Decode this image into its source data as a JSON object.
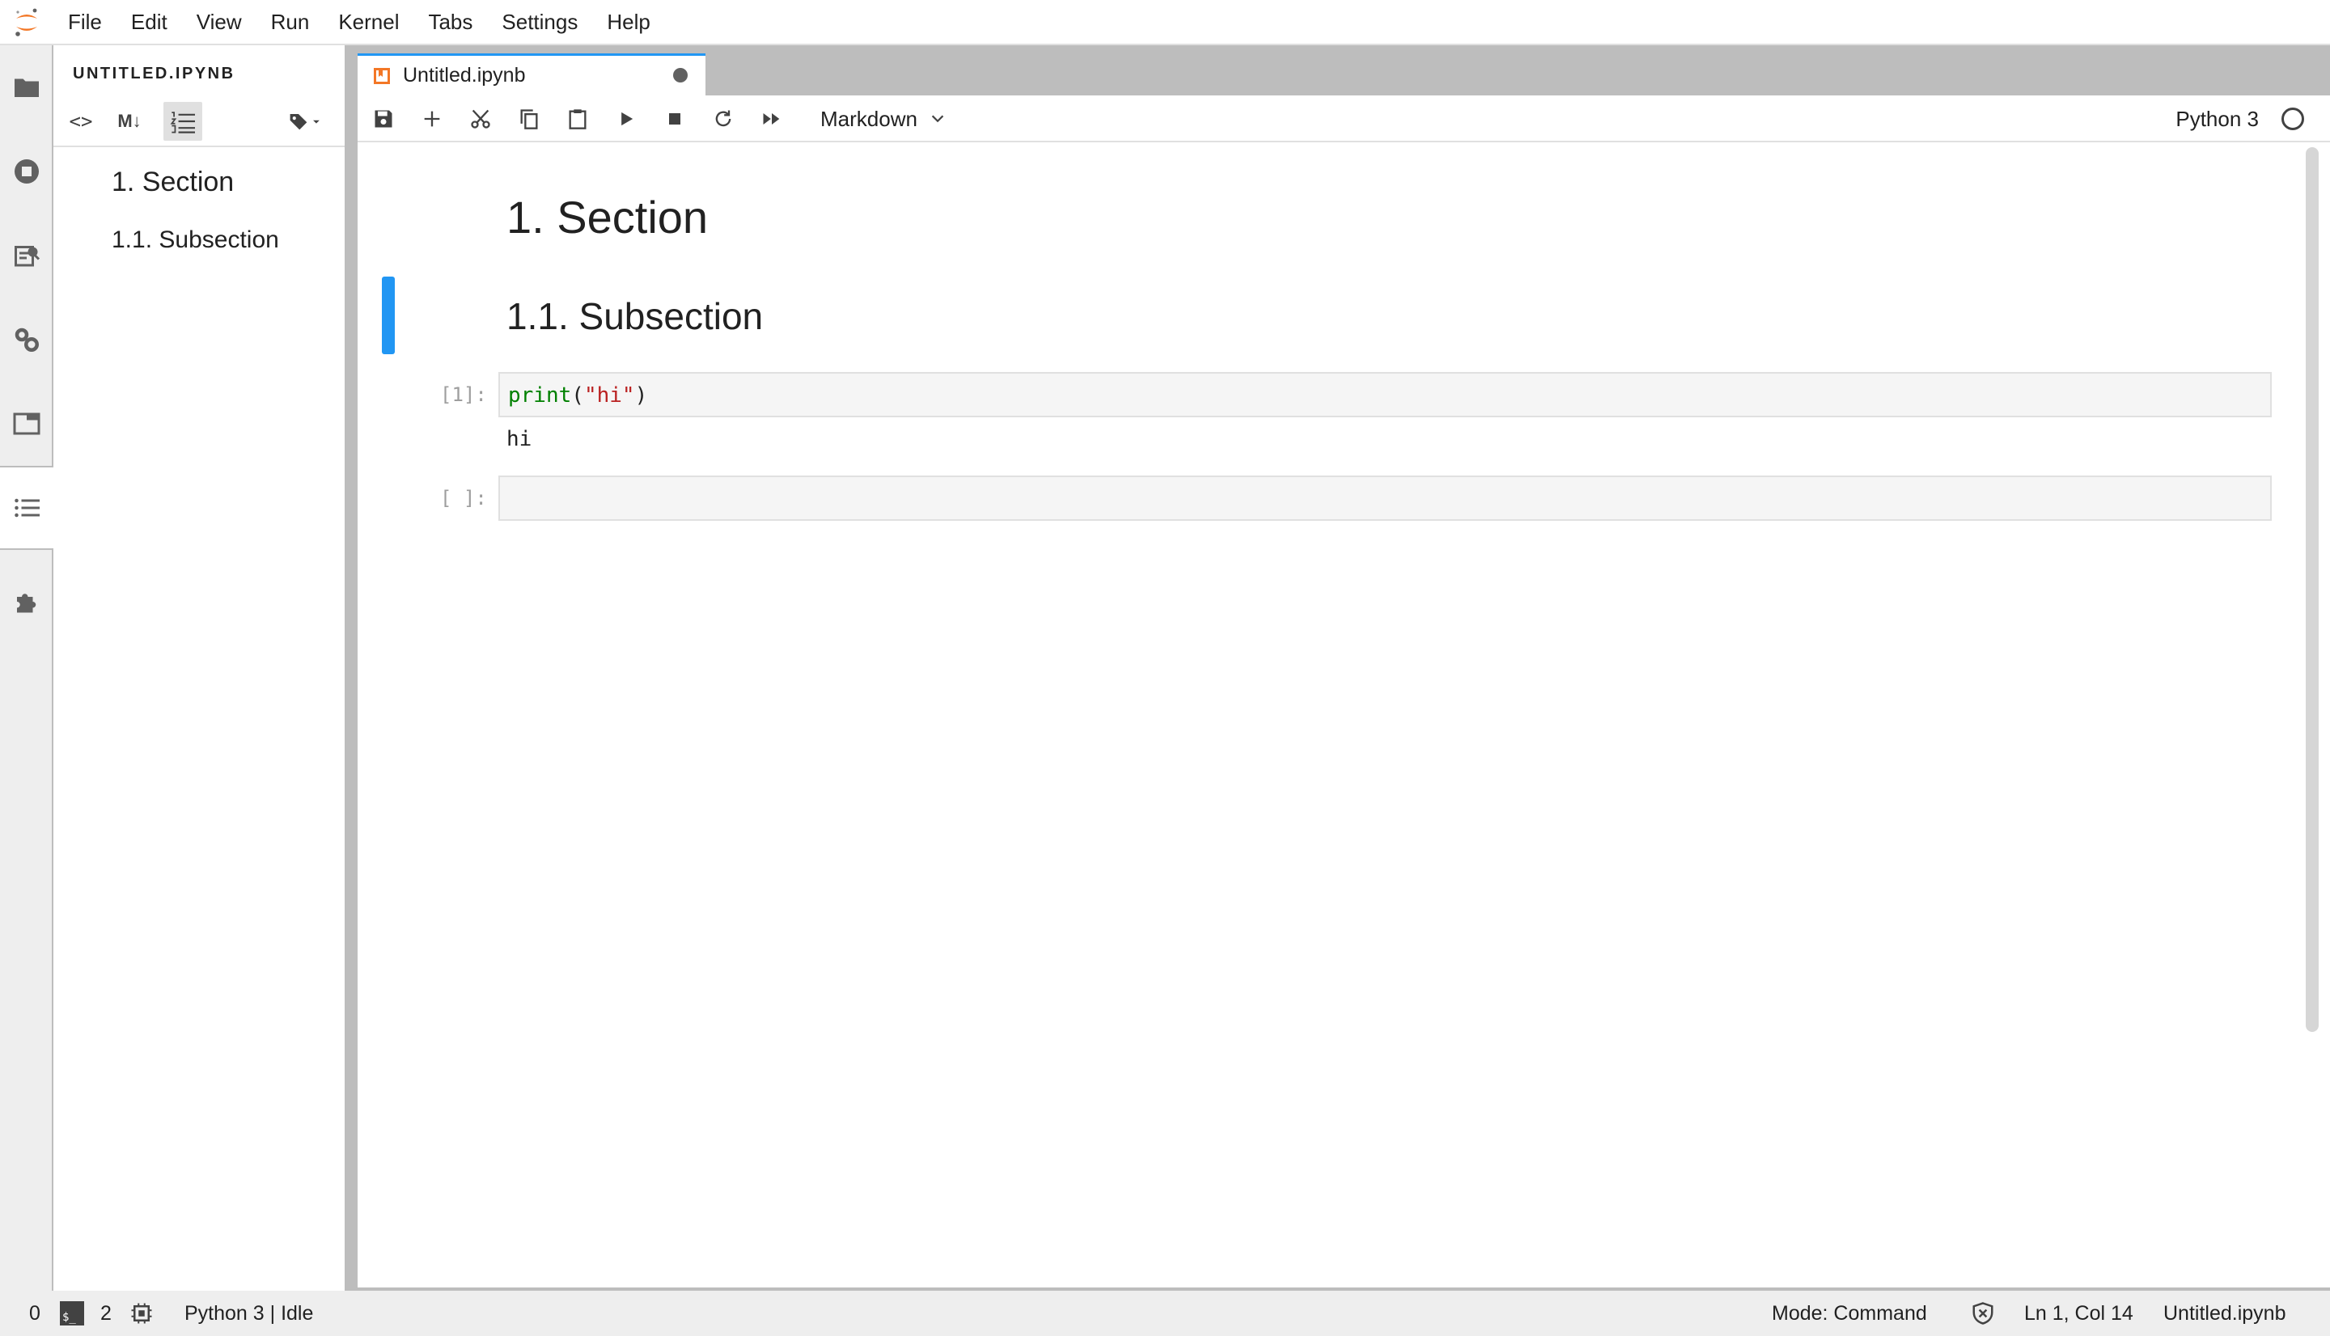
{
  "menubar": {
    "items": [
      "File",
      "Edit",
      "View",
      "Run",
      "Kernel",
      "Tabs",
      "Settings",
      "Help"
    ]
  },
  "activitybar": {
    "icons": [
      "folder-icon",
      "running-icon",
      "commands-icon",
      "property-inspector-icon",
      "tabs-icon",
      "toc-icon",
      "extension-icon"
    ],
    "active": "toc-icon"
  },
  "sidepanel": {
    "title": "UNTITLED.IPYNB",
    "tools": {
      "code": "<>",
      "markdown": "M↓"
    },
    "toc": [
      {
        "label": "1. Section",
        "level": 1
      },
      {
        "label": "1.1. Subsection",
        "level": 2
      }
    ]
  },
  "tab": {
    "label": "Untitled.ipynb",
    "dirty": true
  },
  "toolbar": {
    "cell_type": "Markdown",
    "kernel": "Python 3",
    "buttons": [
      "save-icon",
      "add-icon",
      "cut-icon",
      "copy-icon",
      "paste-icon",
      "run-icon",
      "stop-icon",
      "restart-icon",
      "fast-forward-icon"
    ]
  },
  "notebook": {
    "cells": [
      {
        "type": "markdown",
        "rendered": "1. Section"
      },
      {
        "type": "markdown",
        "rendered": "1.1. Subsection"
      },
      {
        "type": "code",
        "prompt": "[1]:",
        "source": {
          "fn": "print",
          "open": "(",
          "str": "\"hi\"",
          "close": ")"
        },
        "output": "hi"
      },
      {
        "type": "code",
        "prompt": "[ ]:",
        "source": ""
      }
    ]
  },
  "statusbar": {
    "terminals": "0",
    "kernels": "2",
    "kernel_status": "Python 3 | Idle",
    "mode": "Mode: Command",
    "cursor": "Ln 1, Col 14",
    "file": "Untitled.ipynb"
  },
  "colors": {
    "accent": "#2196f3",
    "logo_orange": "#f37726",
    "string": "#ba2121",
    "builtin": "#008000"
  }
}
